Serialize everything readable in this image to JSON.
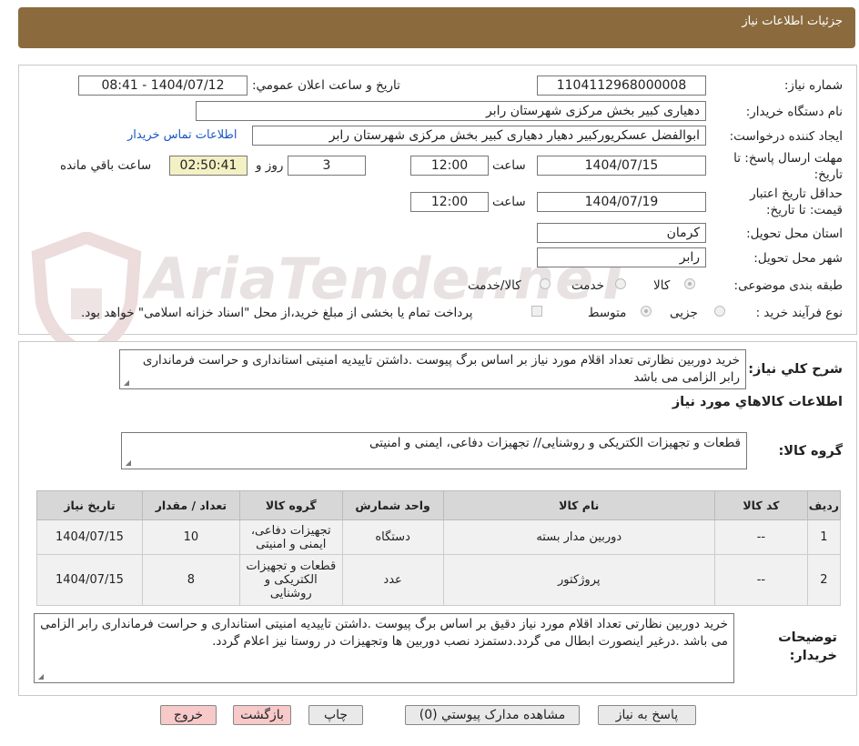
{
  "header": {
    "title": "جزئیات اطلاعات نیاز"
  },
  "watermark": {
    "text": "AriaTender.neT"
  },
  "fields": {
    "need_number_label": "شماره نیاز:",
    "need_number": "1104112968000008",
    "announce_label": "تاریخ و ساعت اعلان عمومي:",
    "announce_value": "1404/07/12 - 08:41",
    "buyer_org_label": "نام دستگاه خریدار:",
    "buyer_org": "دهیاری کبیر بخش مرکزی شهرستان رابر",
    "requester_label": "ایجاد کننده درخواست:",
    "requester": "ابوالفضل عسکریورکبیر دهیار دهیاری کبیر بخش مرکزی شهرستان رابر",
    "contact_link": "اطلاعات تماس خريدار",
    "deadline_label_1": "مهلت ارسال پاسخ: تا",
    "deadline_label_2": "تاریخ:",
    "deadline_date": "1404/07/15",
    "time_label": "ساعت",
    "deadline_time": "12:00",
    "days_value": "3",
    "days_label": "روز و",
    "remaining_time": "02:50:41",
    "remaining_label": "ساعت باقي مانده",
    "validity_label_1": "حداقل تاريخ اعتبار",
    "validity_label_2": "قیمت: تا تاریخ:",
    "validity_date": "1404/07/19",
    "validity_time_label": "ساعت",
    "validity_time": "12:00",
    "province_label": "استان محل تحویل:",
    "province": "کرمان",
    "city_label": "شهر محل تحویل:",
    "city": "رابر",
    "category_label": "طبقه بندی موضوعی:",
    "category_options": [
      "کالا",
      "خدمت",
      "کالا/خدمت"
    ],
    "purchase_type_label": "نوع فرآیند خرید :",
    "purchase_options": [
      "جزیی",
      "متوسط"
    ],
    "payment_note": "پرداخت تمام یا بخشی از مبلغ خرید،از محل \"اسناد خزانه اسلامی\" خواهد بود."
  },
  "summary": {
    "label": "شرح کلي نياز:",
    "text": "خرید دوربین نظارتی تعداد اقلام مورد نیاز بر اساس برگ پیوست .داشتن تاییدیه امنیتی استانداری و حراست فرمانداری رابر الزامی می باشد"
  },
  "goods": {
    "section_title": "اطلاعات کالاهاي مورد نياز",
    "group_label": "گروه کالا:",
    "group_text": "قطعات و تجهیزات الکتریکی و روشنایی// تجهیزات دفاعی، ایمنی و امنیتی"
  },
  "table": {
    "headers": [
      "رديف",
      "کد کالا",
      "نام کالا",
      "واحد شمارش",
      "گروه کالا",
      "تعداد / مقدار",
      "تاريخ نياز"
    ],
    "rows": [
      [
        "1",
        "--",
        "دوربین مدار بسته",
        "دستگاه",
        "تجهیزات دفاعی، ایمنی و امنیتی",
        "10",
        "1404/07/15"
      ],
      [
        "2",
        "--",
        "پروژکتور",
        "عدد",
        "قطعات و تجهیزات الکتریکی و روشنایی",
        "8",
        "1404/07/15"
      ]
    ]
  },
  "buyer_notes": {
    "label_1": "توضیحات",
    "label_2": "خریدار:",
    "text": "خرید دوربین نظارتی تعداد اقلام مورد نیاز دقیق بر اساس برگ پیوست .داشتن تاییدیه امنیتی استانداری و حراست فرمانداری رابر الزامی می باشد .درغیر اینصورت ابطال می گردد.دستمزد نصب دوربین ها وتجهیزات در روستا نیز اعلام گردد."
  },
  "buttons": {
    "reply": "پاسخ به نياز",
    "attachments": "مشاهده مدارک پيوستي (0)",
    "print": "چاپ",
    "back": "بازگشت",
    "exit": "خروج"
  }
}
